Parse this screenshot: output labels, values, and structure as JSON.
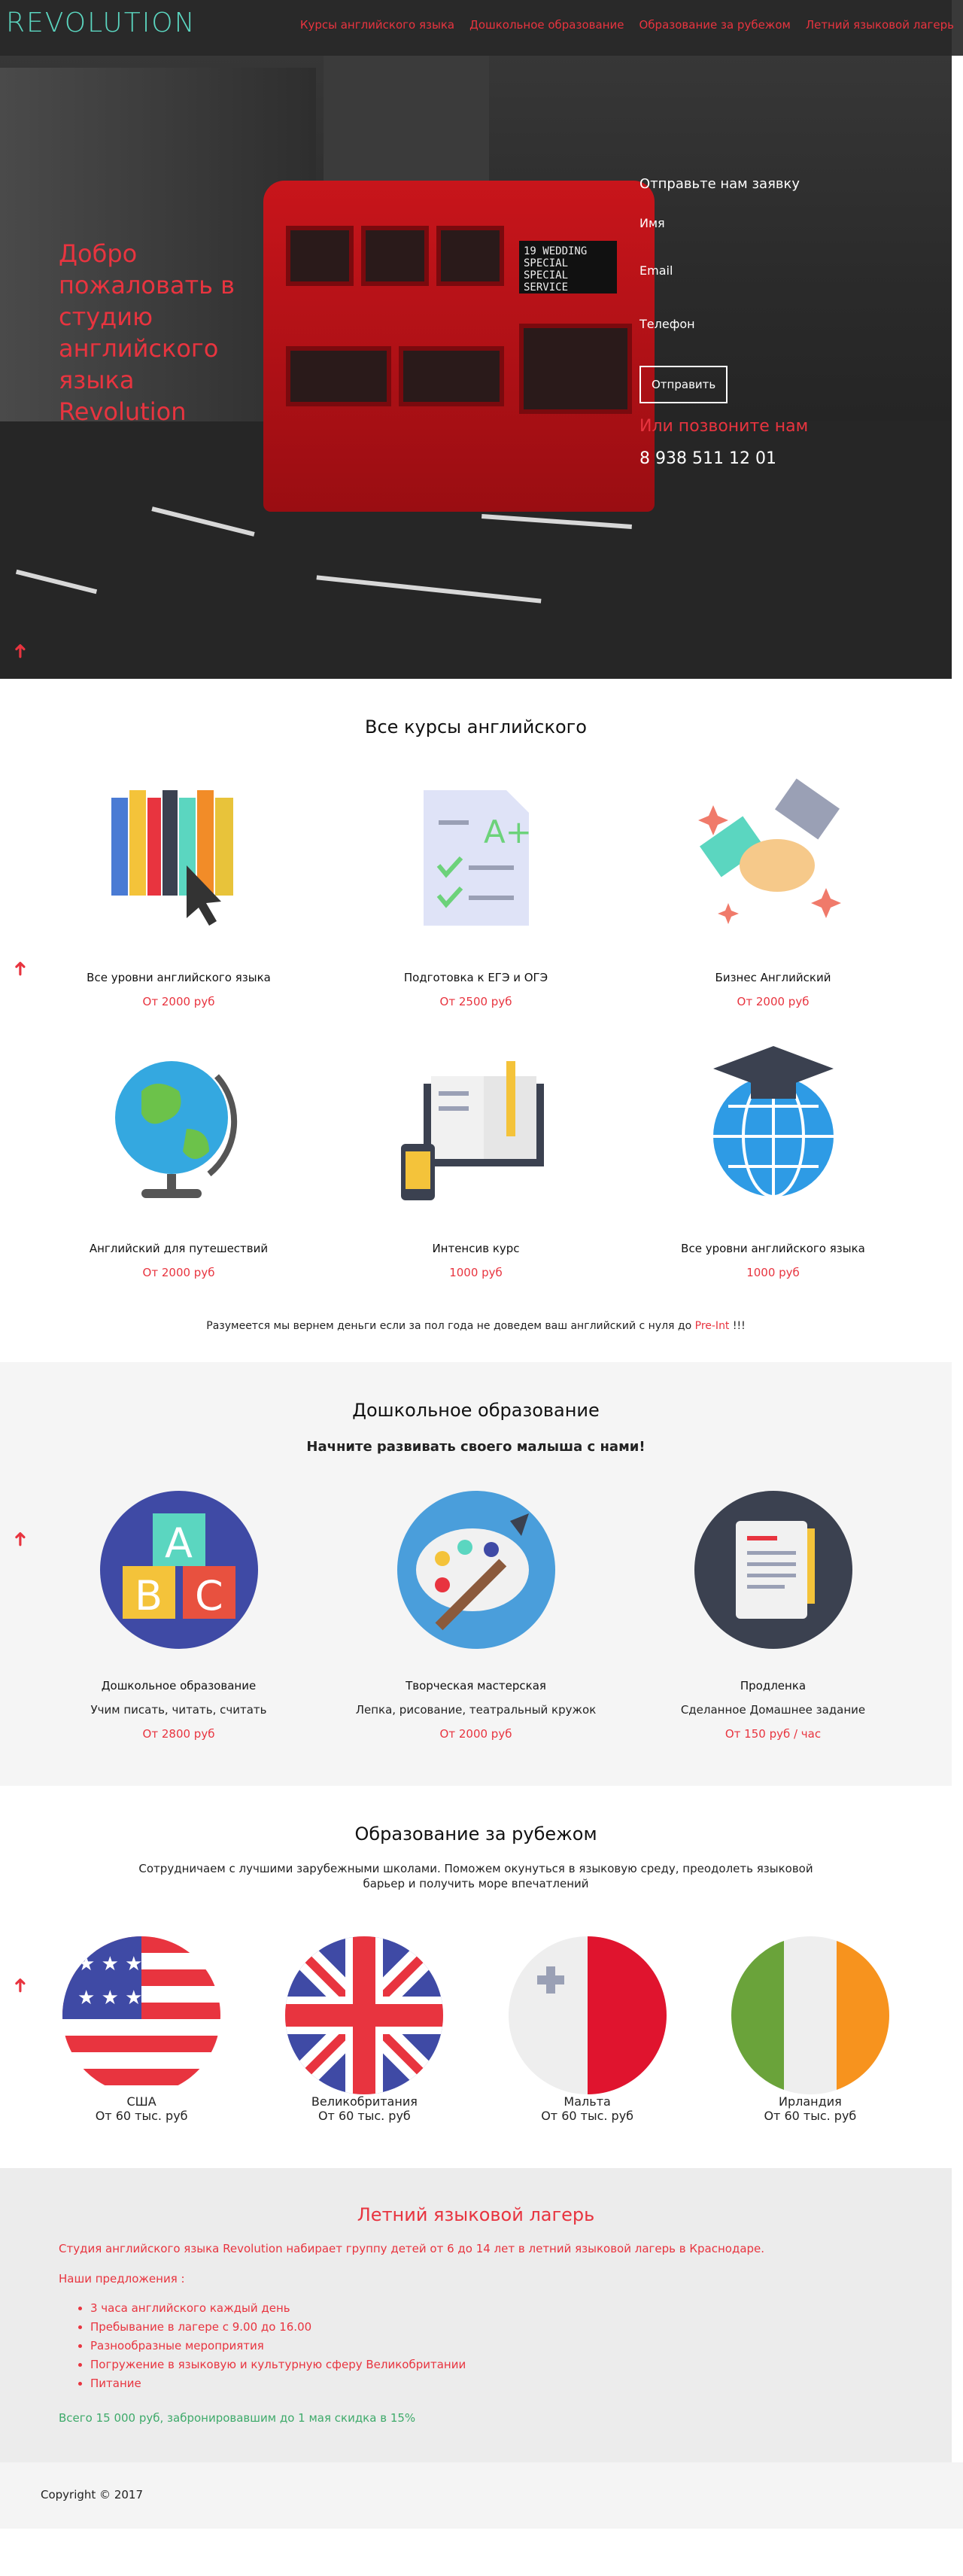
{
  "nav": {
    "logo": "REVOLUTION",
    "links": [
      "Курсы английского языка",
      "Дошкольное образование",
      "Образование за рубежом",
      "Летний языковой лагерь"
    ]
  },
  "hero": {
    "title": "Добро пожаловать в студию английского языка Revolution",
    "form_title": "Отправьте нам заявку",
    "fields": [
      "Имя",
      "Email",
      "Телефон"
    ],
    "submit": "Отправить",
    "call": "Или позвоните нам",
    "phone": "8 938 511 12 01",
    "bus_sign": "19 WEDDING SPECIAL SPECIAL SERVICE"
  },
  "courses": {
    "title": "Все курсы английского",
    "items": [
      {
        "name": "Все уровни английского языка",
        "price": "От 2000 руб",
        "icon": "books-icon"
      },
      {
        "name": "Подготовка к ЕГЭ и ОГЭ",
        "price": "От 2500 руб",
        "icon": "exam-document-icon"
      },
      {
        "name": "Бизнес Английский",
        "price": "От 2000 руб",
        "icon": "handshake-icon"
      },
      {
        "name": "Английский для путешествий",
        "price": "От 2000 руб",
        "icon": "globe-icon"
      },
      {
        "name": "Интенсив курс",
        "price": "1000 руб",
        "icon": "open-book-phone-icon"
      },
      {
        "name": "Все уровни английского языка",
        "price": "1000 руб",
        "icon": "graduation-globe-icon"
      }
    ],
    "note_start": "Разумеется мы вернем деньги если за пол года не доведем ваш английский с нуля до ",
    "note_highlight": "Pre-Int",
    "note_end": " !!!"
  },
  "preschool": {
    "title": "Дошкольное образование",
    "subtitle": "Начните развивать своего малыша с нами!",
    "items": [
      {
        "name": "Дошкольное образование",
        "desc": "Учим писать, читать, считать",
        "price": "От 2800 руб",
        "icon": "abc-blocks-icon",
        "bg": "#3f4aa5"
      },
      {
        "name": "Творческая мастерская",
        "desc": "Лепка, рисование, театральный кружок",
        "price": "От 2000 руб",
        "icon": "palette-icon",
        "bg": "#4a9edb"
      },
      {
        "name": "Продленка",
        "desc": "Сделанное Домашнее задание",
        "price": "От 150 руб / час",
        "icon": "homework-paper-icon",
        "bg": "#3b4150"
      }
    ]
  },
  "abroad": {
    "title": "Образование за рубежом",
    "intro": "Сотрудничаем с лучшими зарубежными школами. Поможем окунуться в языковую среду, преодолеть языковой барьер и получить море впечатлений",
    "items": [
      {
        "name": "США",
        "price": "От 60 тыс. руб",
        "icon": "usa-flag-icon"
      },
      {
        "name": "Великобритания",
        "price": "От 60 тыс. руб",
        "icon": "uk-flag-icon"
      },
      {
        "name": "Мальта",
        "price": "От 60 тыс. руб",
        "icon": "malta-flag-icon"
      },
      {
        "name": "Ирландия",
        "price": "От 60 тыс. руб",
        "icon": "ireland-flag-icon"
      }
    ]
  },
  "camp": {
    "title": "Летний языковой лагерь",
    "text": "Студия английского языка Revolution набирает группу детей от 6 до 14 лет в летний языковой лагерь в Краснодаре.",
    "offers_label": "Наши предложения :",
    "offers": [
      "3 часа английского каждый день",
      "Пребывание в лагере с 9.00 до 16.00",
      "Разнообразные мероприятия",
      "Погружение в языковую и культурную сферу Великобритании",
      "Питание"
    ],
    "total": "Всего 15 000 руб, забронировавшим до 1 мая скидка в 15%"
  },
  "footer": {
    "copyright": "Copyright © 2017"
  },
  "colors": {
    "accent": "#e8343f",
    "logo": "#5bd6c0",
    "green": "#3eaa6a"
  }
}
